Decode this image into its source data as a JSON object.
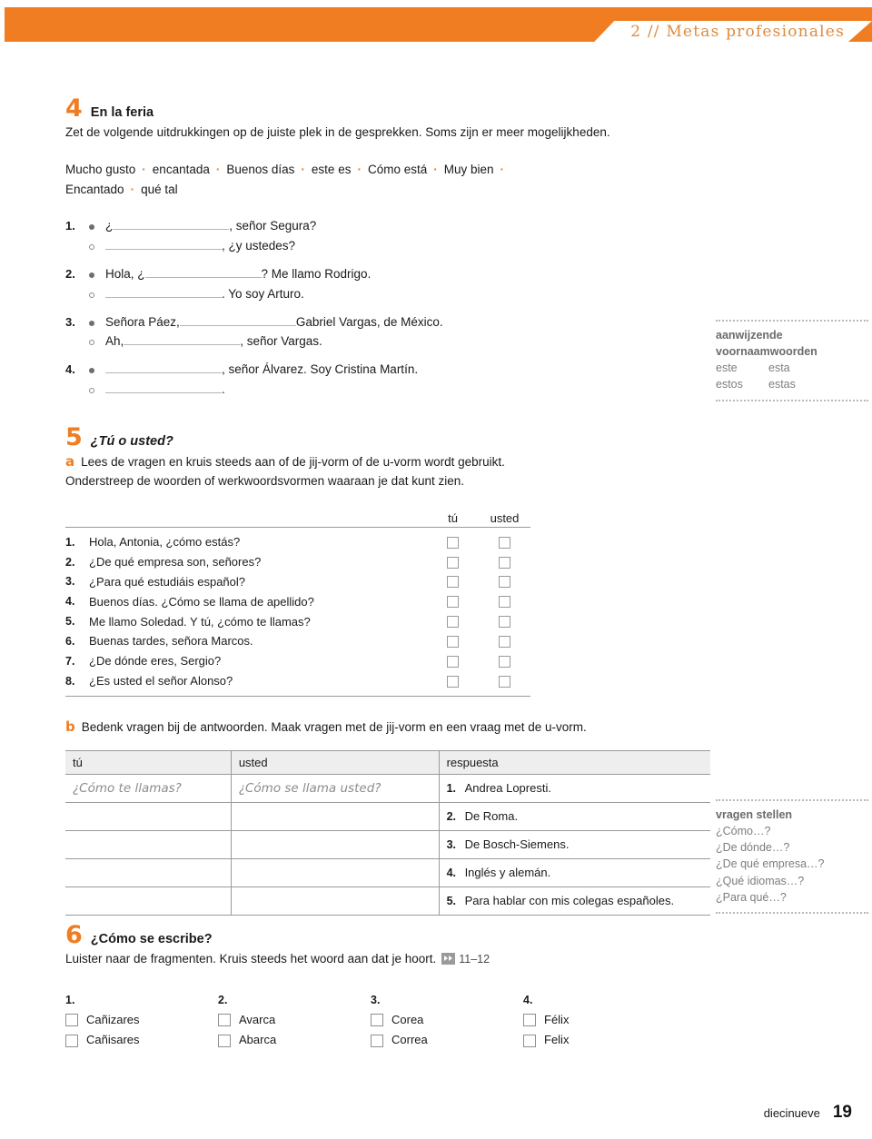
{
  "header": {
    "chapter_label": "2 // Metas profesionales",
    "accent_color": "#f07d22"
  },
  "exercise4": {
    "number": "4",
    "title": "En la feria",
    "instruction": "Zet de volgende uitdrukkingen op de juiste plek in de gesprekken. Soms zijn er meer mogelijkheden.",
    "wordbank": [
      "Mucho gusto",
      "encantada",
      "Buenos días",
      "este es",
      "Cómo está",
      "Muy bien",
      "Encantado",
      "qué tal"
    ],
    "separator": "·",
    "dialogues": [
      {
        "number": "1.",
        "lines": [
          {
            "marker": "filled",
            "before": "¿",
            "blank_width": 128,
            "after": ", señor Segura?"
          },
          {
            "marker": "hollow",
            "before": "",
            "blank_width": 128,
            "after": ", ¿y ustedes?"
          }
        ]
      },
      {
        "number": "2.",
        "lines": [
          {
            "marker": "filled",
            "before": "Hola, ¿",
            "blank_width": 128,
            "after": "? Me llamo Rodrigo."
          },
          {
            "marker": "hollow",
            "before": "",
            "blank_width": 128,
            "after": ". Yo soy Arturo."
          }
        ]
      },
      {
        "number": "3.",
        "lines": [
          {
            "marker": "filled",
            "before": "Señora Páez, ",
            "blank_width": 128,
            "after": " Gabriel Vargas, de México."
          },
          {
            "marker": "hollow",
            "before": "Ah, ",
            "blank_width": 128,
            "after": ", señor Vargas."
          }
        ]
      },
      {
        "number": "4.",
        "lines": [
          {
            "marker": "filled",
            "before": "",
            "blank_width": 128,
            "after": ", señor Álvarez. Soy Cristina Martín."
          },
          {
            "marker": "hollow",
            "before": "",
            "blank_width": 128,
            "after": "."
          }
        ]
      }
    ]
  },
  "sidenote1": {
    "title_line1": "aanwijzende",
    "title_line2": "voornaamwoorden",
    "rows": [
      [
        "este",
        "esta"
      ],
      [
        "estos",
        "estas"
      ]
    ]
  },
  "exercise5": {
    "number": "5",
    "title": "¿Tú o usted?",
    "sub_a": {
      "letter": "a",
      "instruction_line1": "Lees de vragen en kruis steeds aan of de jij-vorm of de u-vorm wordt gebruikt.",
      "instruction_line2": "Onderstreep de woorden of werkwoordsvormen waaraan je dat kunt zien.",
      "columns": [
        "tú",
        "usted"
      ],
      "items": [
        {
          "n": "1.",
          "text": "Hola, Antonia, ¿cómo estás?"
        },
        {
          "n": "2.",
          "text": "¿De qué empresa son, señores?"
        },
        {
          "n": "3.",
          "text": "¿Para qué estudiáis español?"
        },
        {
          "n": "4.",
          "text": "Buenos días. ¿Cómo se llama de apellido?"
        },
        {
          "n": "5.",
          "text": "Me llamo Soledad. Y tú, ¿cómo te llamas?"
        },
        {
          "n": "6.",
          "text": "Buenas tardes, señora Marcos."
        },
        {
          "n": "7.",
          "text": "¿De dónde eres, Sergio?"
        },
        {
          "n": "8.",
          "text": "¿Es usted el señor Alonso?"
        }
      ]
    },
    "sub_b": {
      "letter": "b",
      "instruction": "Bedenk vragen bij de antwoorden. Maak vragen met de jij-vorm en een vraag met de u-vorm.",
      "headers": [
        "tú",
        "usted",
        "respuesta"
      ],
      "rows": [
        {
          "tu": "¿Cómo te llamas?",
          "usted": "¿Cómo se llama usted?",
          "num": "1.",
          "respuesta": "Andrea Lopresti."
        },
        {
          "tu": "",
          "usted": "",
          "num": "2.",
          "respuesta": "De Roma."
        },
        {
          "tu": "",
          "usted": "",
          "num": "3.",
          "respuesta": "De Bosch-Siemens."
        },
        {
          "tu": "",
          "usted": "",
          "num": "4.",
          "respuesta": "Inglés y alemán."
        },
        {
          "tu": "",
          "usted": "",
          "num": "5.",
          "respuesta": "Para hablar con mis colegas españoles."
        }
      ]
    }
  },
  "sidenote2": {
    "title": "vragen stellen",
    "items": [
      "¿Cómo…?",
      "¿De dónde…?",
      "¿De qué empresa…?",
      "¿Qué idiomas…?",
      "¿Para qué…?"
    ]
  },
  "exercise6": {
    "number": "6",
    "title": "¿Cómo se escribe?",
    "instruction": "Luister naar de fragmenten. Kruis steeds het woord aan dat je hoort.",
    "audio_icon": "fast-forward-icon",
    "track": "11–12",
    "groups": [
      {
        "n": "1.",
        "options": [
          "Cañizares",
          "Cañisares"
        ]
      },
      {
        "n": "2.",
        "options": [
          "Avarca",
          "Abarca"
        ]
      },
      {
        "n": "3.",
        "options": [
          "Corea",
          "Correa"
        ]
      },
      {
        "n": "4.",
        "options": [
          "Félix",
          "Felix"
        ]
      }
    ]
  },
  "footer": {
    "word": "diecinueve",
    "page": "19"
  }
}
